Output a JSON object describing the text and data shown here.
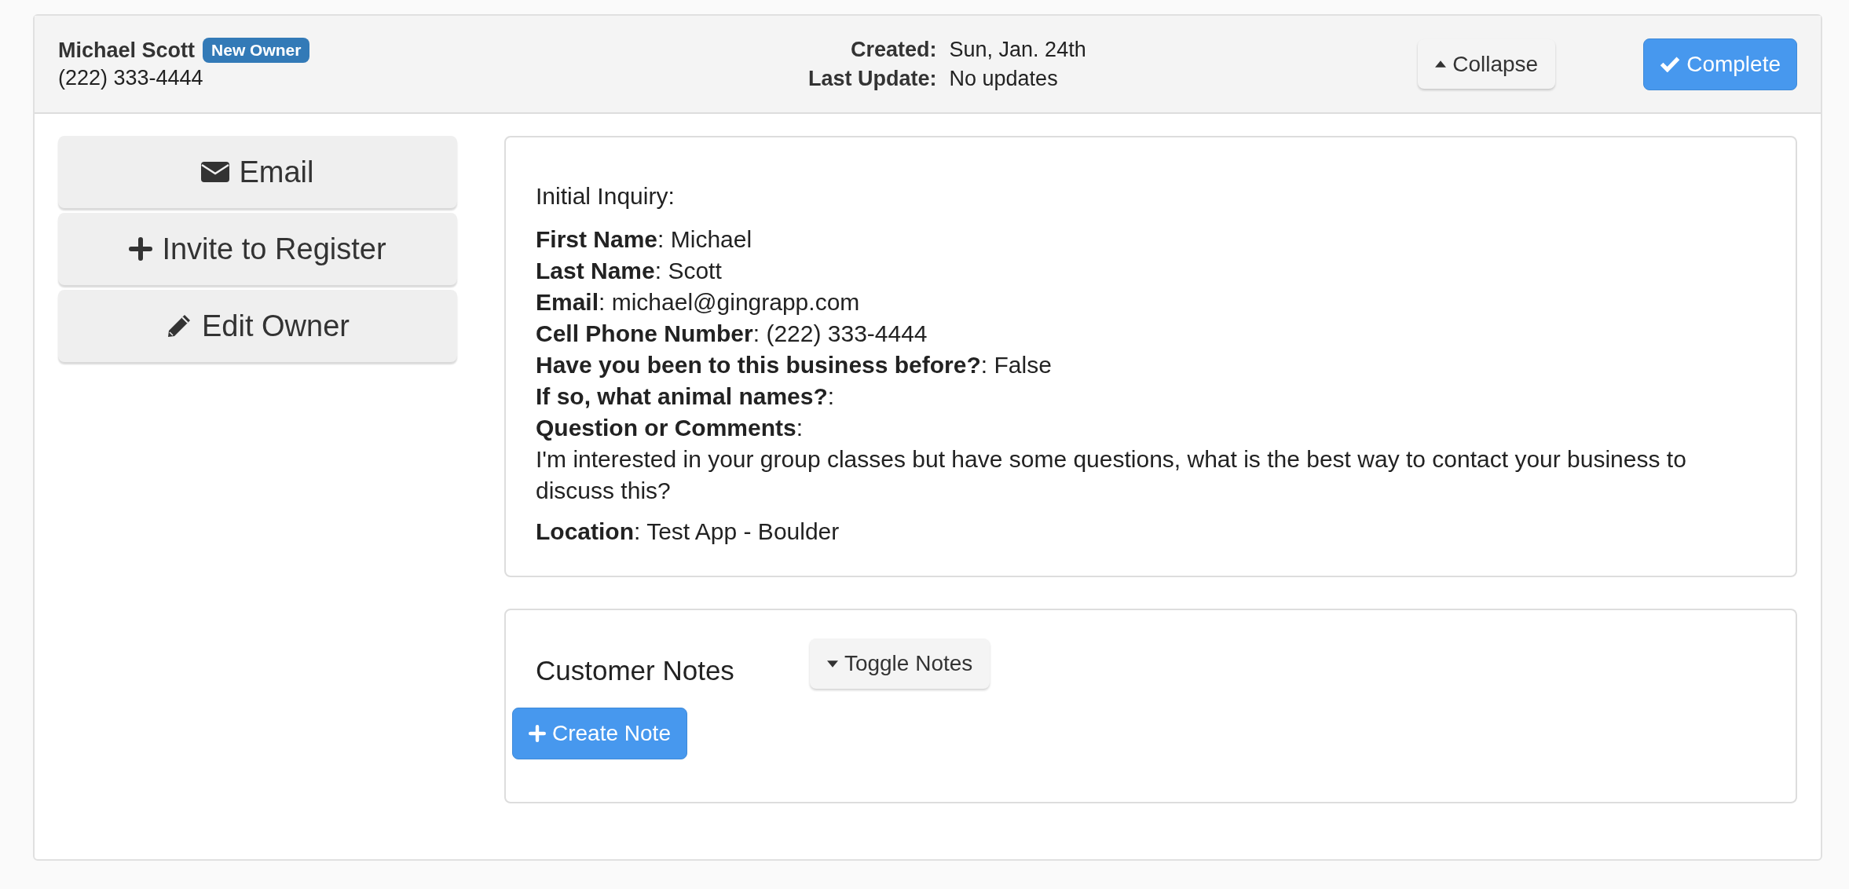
{
  "header": {
    "name": "Michael Scott",
    "badge": "New Owner",
    "phone": "(222) 333-4444",
    "meta": [
      {
        "label": "Created:",
        "value": "Sun, Jan. 24th"
      },
      {
        "label": "Last Update:",
        "value": "No updates"
      }
    ],
    "buttons": [
      {
        "kind": "collapse",
        "label": "Collapse"
      },
      {
        "kind": "complete",
        "label": "Complete"
      }
    ]
  },
  "actions": [
    {
      "kind": "email",
      "label": "Email"
    },
    {
      "kind": "invite",
      "label": "Invite to Register"
    },
    {
      "kind": "edit",
      "label": "Edit Owner"
    }
  ],
  "inquiry": {
    "heading": "Initial Inquiry:",
    "fields": [
      {
        "kind": "inline",
        "text": "**First Name**: Michael"
      },
      {
        "kind": "inline",
        "text": "**Last Name**: Scott"
      },
      {
        "kind": "inline",
        "text": "**Email**: michael@gingrapp.com"
      },
      {
        "kind": "inline",
        "text": "**Cell Phone Number**: (222) 333-4444"
      },
      {
        "kind": "inline",
        "text": "**Have you been to this business before?**: False"
      },
      {
        "kind": "inline",
        "text": "**If so, what animal names?**:"
      },
      {
        "kind": "inline",
        "text": "**Question or Comments**:"
      },
      {
        "kind": "inline",
        "text": "I'm interested in your group classes but have some questions, what is the best way to contact your business to discuss this?"
      }
    ],
    "location": {
      "kind": "spaced",
      "text": "**Location**: Test App - Boulder"
    }
  },
  "notes": {
    "title": "Customer Notes",
    "toggle": "Toggle Notes",
    "create": "Create Note"
  }
}
